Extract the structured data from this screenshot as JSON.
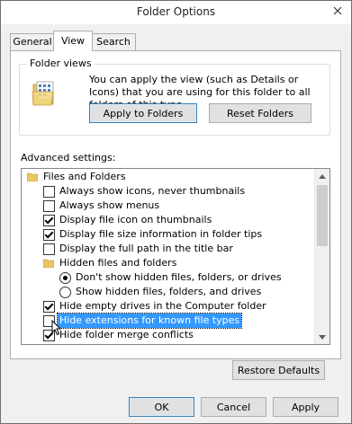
{
  "window": {
    "title": "Folder Options"
  },
  "tabs": [
    {
      "label": "General",
      "active": false
    },
    {
      "label": "View",
      "active": true
    },
    {
      "label": "Search",
      "active": false
    }
  ],
  "folder_views": {
    "label": "Folder views",
    "description": "You can apply the view (such as Details or Icons) that you are using for this folder to all folders of this type.",
    "apply_button": "Apply to Folders",
    "reset_button": "Reset Folders"
  },
  "advanced": {
    "label": "Advanced settings:",
    "items": [
      {
        "type": "folder",
        "label": "Files and Folders"
      },
      {
        "type": "checkbox",
        "label": "Always show icons, never thumbnails",
        "checked": false
      },
      {
        "type": "checkbox",
        "label": "Always show menus",
        "checked": false
      },
      {
        "type": "checkbox",
        "label": "Display file icon on thumbnails",
        "checked": true
      },
      {
        "type": "checkbox",
        "label": "Display file size information in folder tips",
        "checked": true
      },
      {
        "type": "checkbox",
        "label": "Display the full path in the title bar",
        "checked": false
      },
      {
        "type": "folder",
        "label": "Hidden files and folders"
      },
      {
        "type": "radio",
        "label": "Don't show hidden files, folders, or drives",
        "checked": true
      },
      {
        "type": "radio",
        "label": "Show hidden files, folders, and drives",
        "checked": false
      },
      {
        "type": "checkbox",
        "label": "Hide empty drives in the Computer folder",
        "checked": true
      },
      {
        "type": "checkbox",
        "label": "Hide extensions for known file types",
        "checked": false,
        "selected": true
      },
      {
        "type": "checkbox",
        "label": "Hide folder merge conflicts",
        "checked": true
      }
    ]
  },
  "restore_defaults": "Restore Defaults",
  "buttons": {
    "ok": "OK",
    "cancel": "Cancel",
    "apply": "Apply"
  },
  "colors": {
    "selection": "#3399ff",
    "accent_border": "#3c7fb1"
  }
}
